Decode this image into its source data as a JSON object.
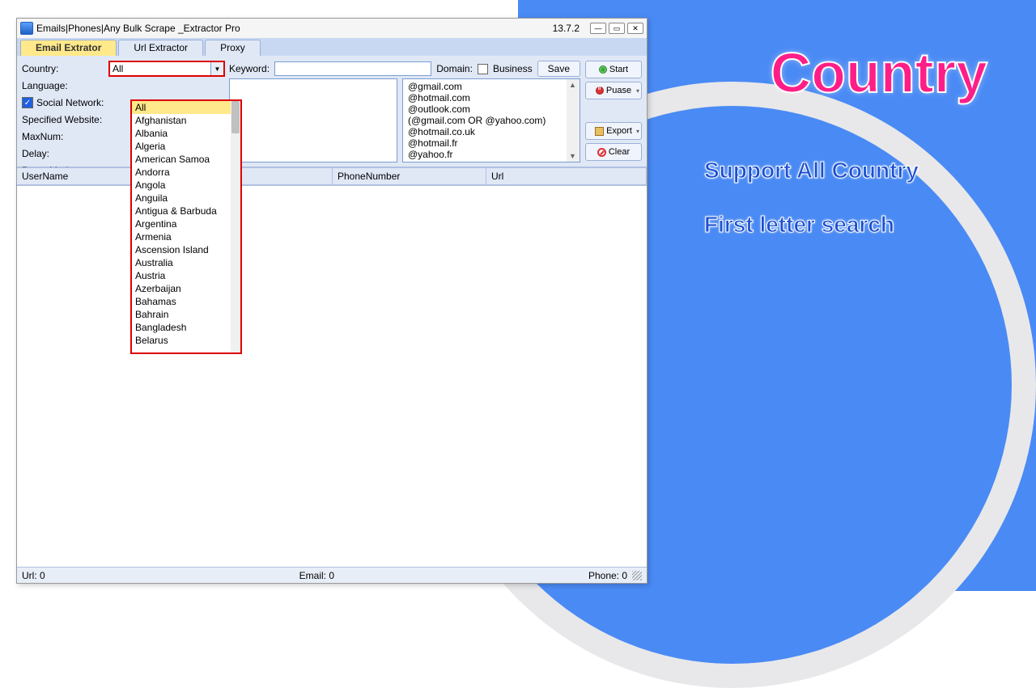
{
  "promo": {
    "title": "Country",
    "line1": "Support All Country",
    "line2": "First letter search"
  },
  "window": {
    "title": "Emails|Phones|Any Bulk Scrape _Extractor Pro",
    "version": "13.7.2"
  },
  "tabs": [
    "Email Extrator",
    "Url Extractor",
    "Proxy"
  ],
  "activeTab": 0,
  "form": {
    "country_label": "Country:",
    "country_value": "All",
    "language_label": "Language:",
    "social_label": "Social Network:",
    "specified_label": "Specified Website:",
    "maxnum_label": "MaxNum:",
    "delay_label": "Delay:",
    "proxymode_label": "Proxy Mode:",
    "keyword_label": "Keyword:",
    "domain_label": "Domain:",
    "business_label": "Business",
    "save_label": "Save"
  },
  "domains": [
    "@gmail.com",
    "@hotmail.com",
    "@outlook.com",
    "(@gmail.com OR @yahoo.com)",
    "@hotmail.co.uk",
    "@hotmail.fr",
    "@yahoo.fr"
  ],
  "buttons": {
    "start": "Start",
    "pause": "Puase",
    "export": "Export",
    "clear": "Clear"
  },
  "grid_headers": [
    "UserName",
    "PhoneNumber",
    "Url"
  ],
  "status": {
    "url": "Url:  0",
    "email": "Email:  0",
    "phone": "Phone:  0"
  },
  "dropdown_items": [
    "All",
    "Afghanistan",
    "Albania",
    "Algeria",
    "American Samoa",
    "Andorra",
    "Angola",
    "Anguila",
    "Antigua & Barbuda",
    "Argentina",
    "Armenia",
    "Ascension Island",
    "Australia",
    "Austria",
    "Azerbaijan",
    "Bahamas",
    "Bahrain",
    "Bangladesh",
    "Belarus"
  ]
}
